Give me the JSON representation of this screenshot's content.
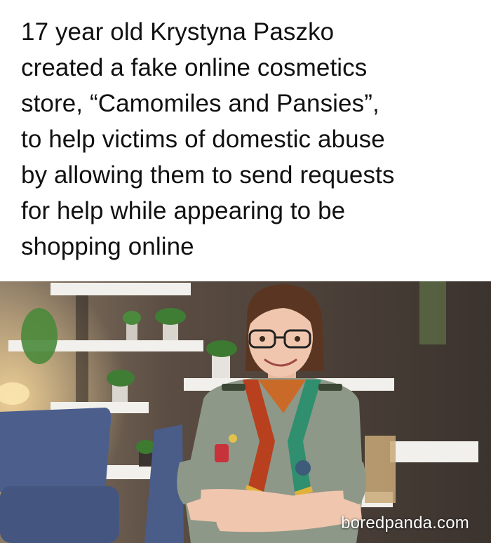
{
  "caption": {
    "lines": [
      "17 year old Krystyna Paszko",
      "created a fake online cosmetics",
      "store, “Camomiles and Pansies”,",
      "to help victims of domestic abuse",
      "by allowing them to send requests",
      "for help while appearing to be",
      "shopping online"
    ]
  },
  "photo": {
    "watermark": "boredpanda.com",
    "colors": {
      "wall": "#4a3f38",
      "shelf": "#f2f0ec",
      "plant": "#3f7d34",
      "chair": "#4c5f8c",
      "uniform": "#8e9888",
      "scarf_red": "#b8401f",
      "scarf_green": "#2f8f6e",
      "scarf_yellow": "#e0b23a",
      "skin": "#f0c7ae",
      "hair": "#5a3622"
    }
  }
}
